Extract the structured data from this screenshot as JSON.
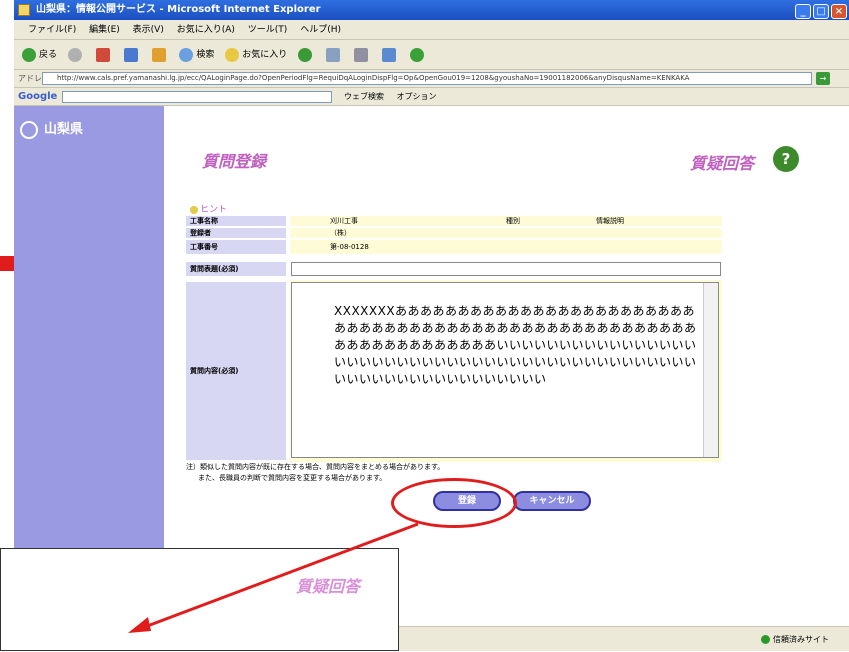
{
  "window": {
    "title": "山梨県：情報公開サービス - Microsoft Internet Explorer",
    "buttons": [
      "_",
      "□",
      "×"
    ]
  },
  "menu": [
    "ファイル(F)",
    "編集(E)",
    "表示(V)",
    "お気に入り(A)",
    "ツール(T)",
    "ヘルプ(H)"
  ],
  "toolbar": {
    "back_label": "戻る",
    "search_label": "検索",
    "favorites_label": "お気に入り"
  },
  "address": {
    "label": "アドレス(D)",
    "url": "http://www.cals.pref.yamanashi.lg.jp/ecc/QALoginPage.do?OpenPeriodFlg=RequiDqALoginDispFlg=Op&OpenGou019=1208&gyoushaNo=19001182006&anyDisqusName=KENKAKA"
  },
  "google": {
    "logo": "Google",
    "search_label": "ウェブ検索",
    "options_label": "オプション"
  },
  "site": {
    "logo": "山梨県"
  },
  "page": {
    "heading_left": "質問登録",
    "heading_right": "質疑回答",
    "help_icon_text": "?",
    "hint_label": "ヒント"
  },
  "form": {
    "rows": [
      {
        "label": "工事名称",
        "value": "刈川工事",
        "extra_label": "種別",
        "extra_value": "情報説明"
      },
      {
        "label": "登録者",
        "value": "（株）"
      },
      {
        "label": "工事番号",
        "value": "第-08-0128"
      }
    ],
    "subject_label": "質問表題(必須)",
    "body_label": "質問内容(必須)",
    "body_text": "XXXXXXXああああああああああああああああああああああああああああああああああああああああああああああああああああああああああああああああああいいいいいいいいいいいいいいいいいいいいいいいいいいいいいいいいいいいいいいいいいいいいいいいいいいいいいいいいいいいいいい"
  },
  "note": {
    "line1": "注）類似した質問内容が既に存在する場合、質問内容をまとめる場合があります。",
    "line2": "また、長職員の判断で質問内容を変更する場合があります。"
  },
  "buttons": {
    "register": "登録",
    "cancel": "キャンセル"
  },
  "status": {
    "zone": "信頼済みサイト"
  },
  "inset": {
    "logo": "質疑回答"
  },
  "colors": {
    "accent": "#c060c0",
    "side_band": "#9a9ae3",
    "highlight_circle": "#e01c1c"
  }
}
